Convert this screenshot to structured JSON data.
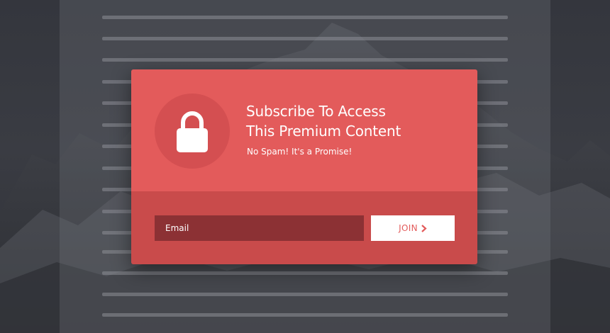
{
  "modal": {
    "title_line1": "Subscribe To Access",
    "title_line2": "This Premium Content",
    "subtitle": "No Spam! It's a Promise!",
    "icon": "lock-icon",
    "email_placeholder": "Email",
    "email_value": "",
    "join_label": "JOIN",
    "join_icon": "chevron-right-icon"
  },
  "colors": {
    "modal_accent": "#e35b5b",
    "modal_footer": "#c94b4b",
    "lock_circle": "#d44f51",
    "email_field": "#8c3134",
    "join_button_bg": "#ffffff",
    "page_background": "#35373e"
  }
}
